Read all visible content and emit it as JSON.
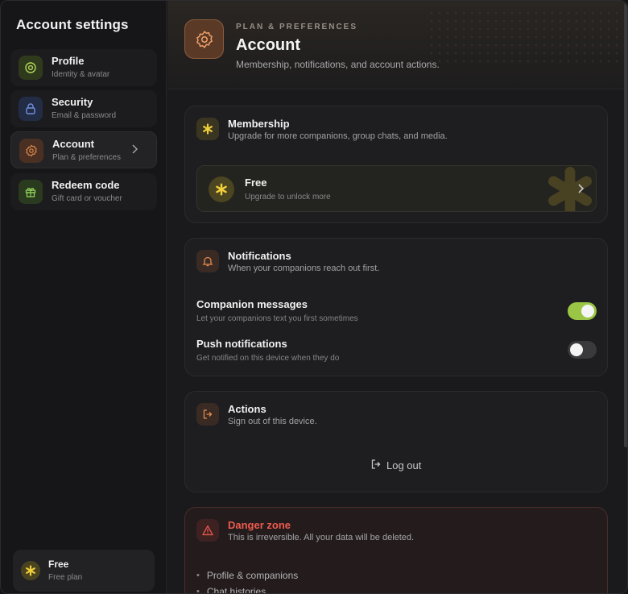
{
  "sidebar": {
    "title": "Account settings",
    "items": [
      {
        "label": "Profile",
        "sub": "Identity & avatar",
        "icon": "at-sign-icon",
        "color": "#b5d65a"
      },
      {
        "label": "Security",
        "sub": "Email & password",
        "icon": "lock-icon",
        "color": "#6f8fe0"
      },
      {
        "label": "Account",
        "sub": "Plan & preferences",
        "icon": "gear-icon",
        "color": "#e08a4e",
        "active": true
      },
      {
        "label": "Redeem code",
        "sub": "Gift card or voucher",
        "icon": "gift-icon",
        "color": "#8fcf5a"
      }
    ],
    "plan": {
      "name": "Free",
      "sub": "Free plan"
    }
  },
  "header": {
    "kicker": "PLAN & PREFERENCES",
    "title": "Account",
    "description": "Membership, notifications, and account actions."
  },
  "membership": {
    "title": "Membership",
    "description": "Upgrade for more companions, group chats, and media.",
    "plan_name": "Free",
    "plan_sub": "Upgrade to unlock more"
  },
  "notifications": {
    "title": "Notifications",
    "description": "When your companions reach out first.",
    "settings": [
      {
        "label": "Companion messages",
        "sub": "Let your companions text you first sometimes",
        "on": true
      },
      {
        "label": "Push notifications",
        "sub": "Get notified on this device when they do",
        "on": false
      }
    ]
  },
  "actions": {
    "title": "Actions",
    "description": "Sign out of this device.",
    "logout_label": "Log out"
  },
  "danger": {
    "title": "Danger zone",
    "description": "This is irreversible. All your data will be deleted.",
    "items": [
      "Profile & companions",
      "Chat histories"
    ]
  },
  "colors": {
    "accent_orange": "#e08a4e",
    "toggle_on": "#9bc544",
    "danger_red": "#ee5a4e",
    "star_yellow": "#f1cf3a"
  }
}
